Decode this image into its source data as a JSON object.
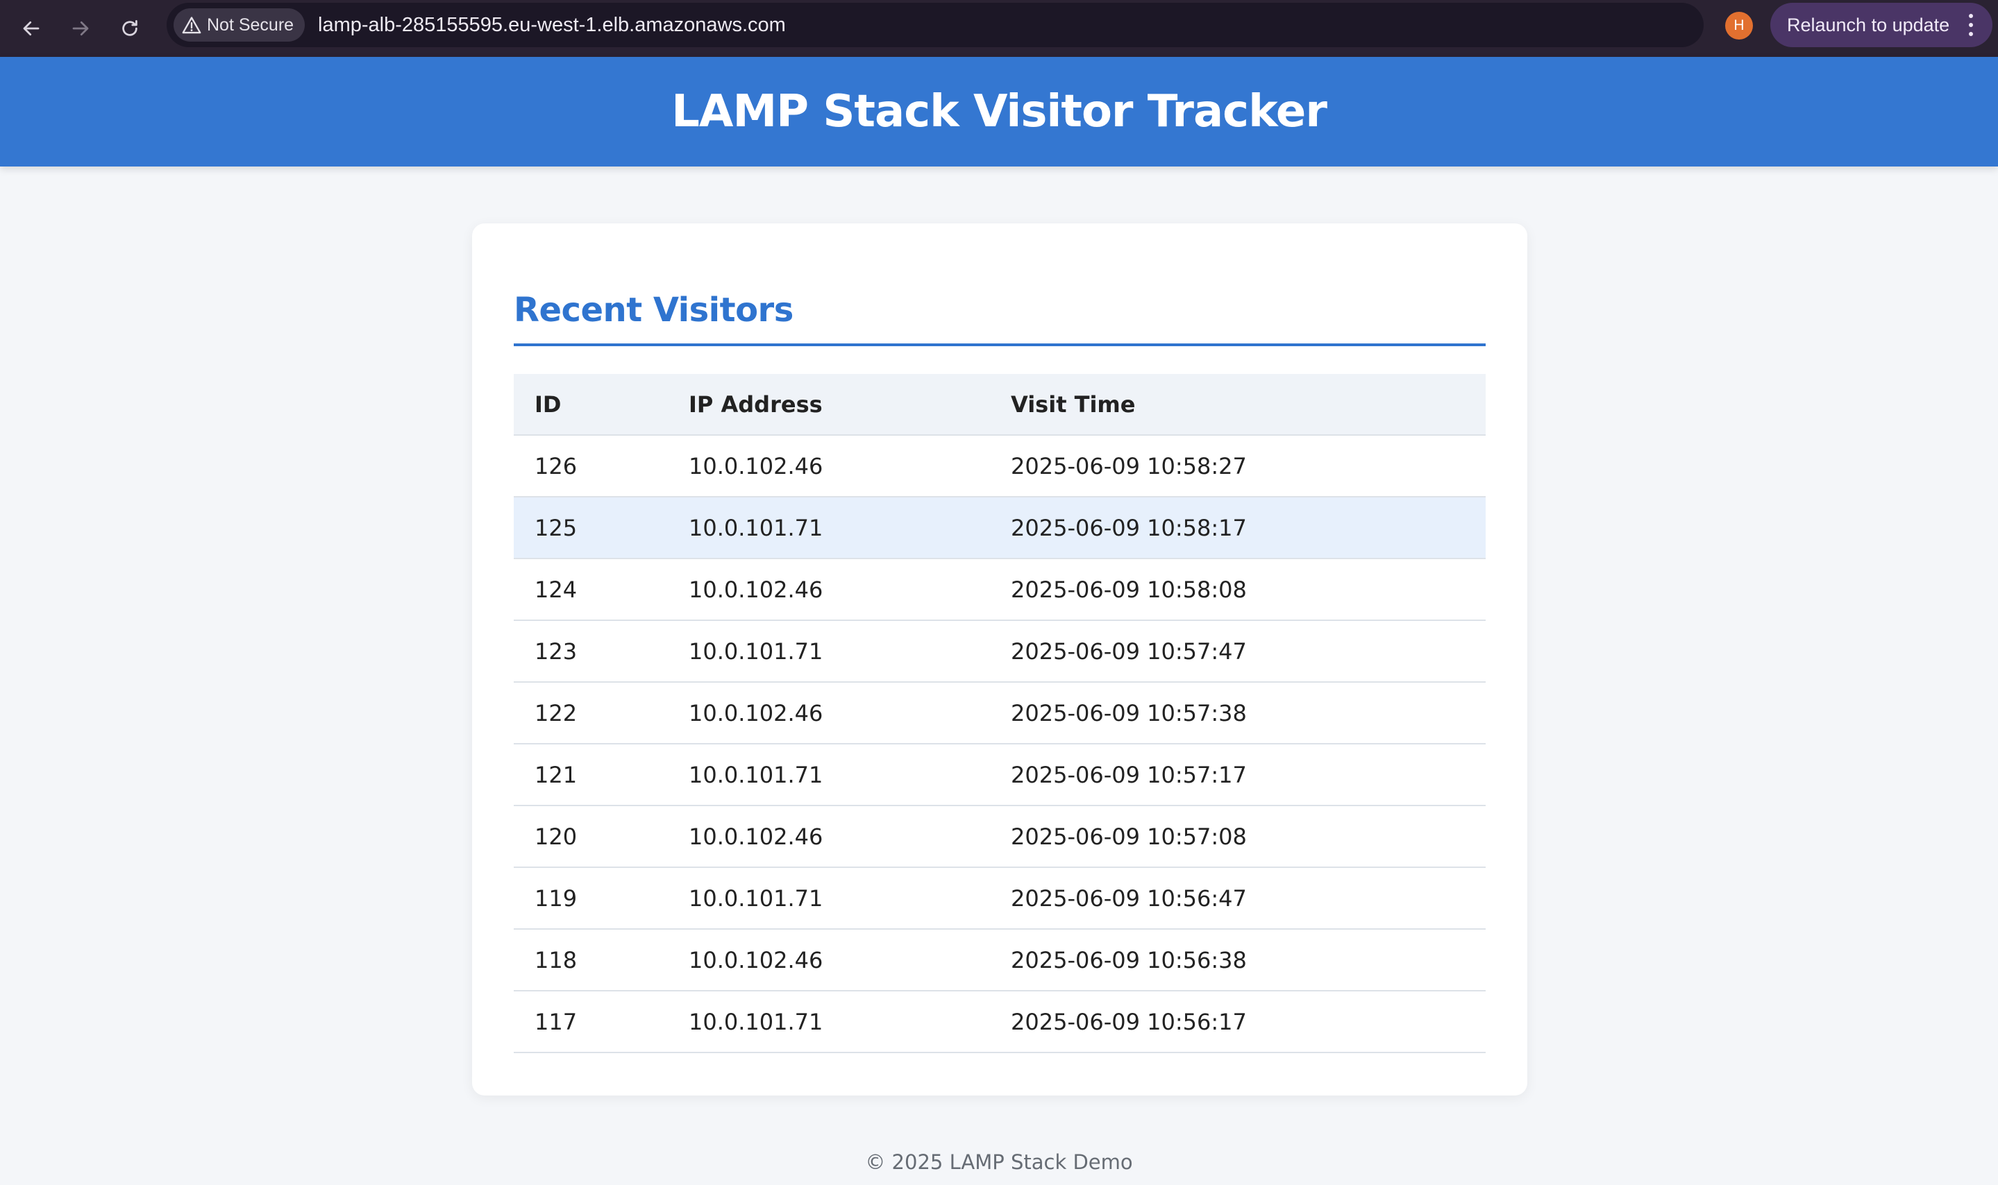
{
  "browser": {
    "security_label": "Not Secure",
    "url": "lamp-alb-285155595.eu-west-1.elb.amazonaws.com",
    "profile_initial": "H",
    "relaunch_label": "Relaunch to update",
    "icons": [
      "back-icon",
      "forward-icon",
      "reload-icon",
      "warning-icon",
      "star-icon",
      "more-vert-icon"
    ]
  },
  "header": {
    "title": "LAMP Stack Visitor Tracker"
  },
  "visitors": {
    "title": "Recent Visitors",
    "columns": [
      "ID",
      "IP Address",
      "Visit Time"
    ],
    "rows": [
      {
        "id": "126",
        "ip": "10.0.102.46",
        "time": "2025-06-09 10:58:27"
      },
      {
        "id": "125",
        "ip": "10.0.101.71",
        "time": "2025-06-09 10:58:17"
      },
      {
        "id": "124",
        "ip": "10.0.102.46",
        "time": "2025-06-09 10:58:08"
      },
      {
        "id": "123",
        "ip": "10.0.101.71",
        "time": "2025-06-09 10:57:47"
      },
      {
        "id": "122",
        "ip": "10.0.102.46",
        "time": "2025-06-09 10:57:38"
      },
      {
        "id": "121",
        "ip": "10.0.101.71",
        "time": "2025-06-09 10:57:17"
      },
      {
        "id": "120",
        "ip": "10.0.102.46",
        "time": "2025-06-09 10:57:08"
      },
      {
        "id": "119",
        "ip": "10.0.101.71",
        "time": "2025-06-09 10:56:47"
      },
      {
        "id": "118",
        "ip": "10.0.102.46",
        "time": "2025-06-09 10:56:38"
      },
      {
        "id": "117",
        "ip": "10.0.101.71",
        "time": "2025-06-09 10:56:17"
      }
    ]
  },
  "footer": {
    "text": "© 2025 LAMP Stack Demo"
  },
  "colors": {
    "brand": "#3477d1",
    "accent": "#2f74cf",
    "row_highlight": "#e7f0fc",
    "page_bg": "#f4f6f9"
  }
}
